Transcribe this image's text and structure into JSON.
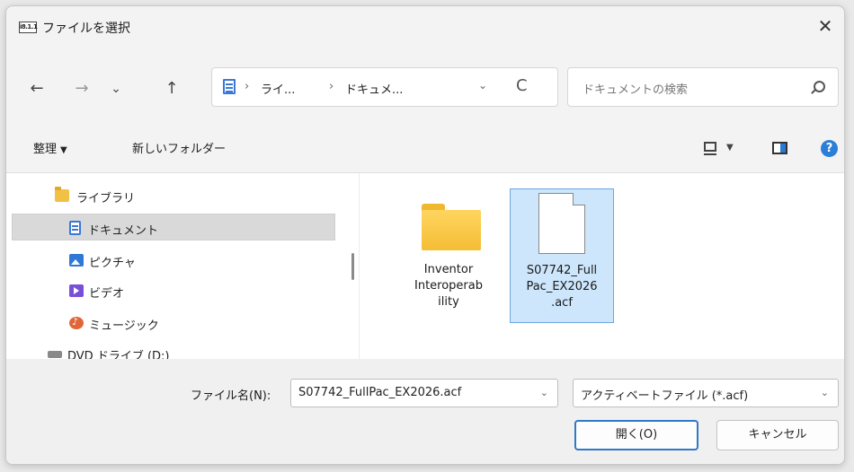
{
  "window": {
    "app_icon_text": "i8.1.1",
    "title": "ファイルを選択",
    "close_glyph": "✕"
  },
  "navigation": {
    "back_glyph": "←",
    "forward_glyph": "→",
    "recent_glyph": "⌄",
    "up_glyph": "↑",
    "breadcrumb": [
      "ライ...",
      "ドキュメ..."
    ],
    "separator": "›",
    "refresh_glyph": "C",
    "dropdown_glyph": "⌄",
    "search_placeholder": "ドキュメントの検索"
  },
  "toolbar": {
    "organize_label": "整理",
    "new_folder_label": "新しいフォルダー",
    "caret": "▼",
    "help_glyph": "?"
  },
  "nav_pane": {
    "items": [
      {
        "label": "ライブラリ",
        "icon": "library-icon"
      },
      {
        "label": "ドキュメント",
        "icon": "documents-icon",
        "selected": true
      },
      {
        "label": "ピクチャ",
        "icon": "pictures-icon"
      },
      {
        "label": "ビデオ",
        "icon": "videos-icon"
      },
      {
        "label": "ミュージック",
        "icon": "music-icon"
      },
      {
        "label": "DVD ドライブ (D:)",
        "icon": "dvd-drive-icon"
      }
    ]
  },
  "files": [
    {
      "name": "Inventor Interoperability",
      "lines": [
        "Inventor",
        "Interoperab",
        "ility"
      ],
      "icon": "folder-icon",
      "selected": false
    },
    {
      "name": "S07742_FullPac_EX2026.acf",
      "lines": [
        "S07742_Full",
        "Pac_EX2026",
        ".acf"
      ],
      "icon": "file-icon",
      "selected": true
    }
  ],
  "bottom": {
    "filename_label": "ファイル名(N):",
    "filename_value": "S07742_FullPac_EX2026.acf",
    "filetype_value": "アクティベートファイル (*.acf)",
    "open_label": "開く(O)",
    "cancel_label": "キャンセル",
    "caret": "⌄"
  }
}
